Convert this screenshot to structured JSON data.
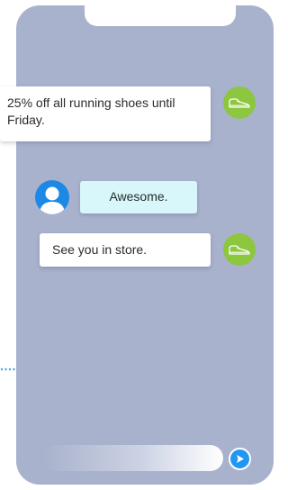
{
  "chat": {
    "messages": [
      {
        "sender": "store",
        "text": "25% off all running shoes until Friday.",
        "avatar_icon": "sneaker-icon"
      },
      {
        "sender": "user",
        "text": "Awesome.",
        "avatar_icon": "user-avatar-icon"
      },
      {
        "sender": "store",
        "text": "See you in store.",
        "avatar_icon": "sneaker-icon"
      }
    ]
  },
  "composer": {
    "placeholder": "",
    "send_icon": "send-icon"
  },
  "colors": {
    "phone_background": "#a9b2cc",
    "store_avatar": "#8dc63f",
    "user_avatar": "#1e88e5",
    "user_bubble": "#d7f7fb",
    "bot_bubble": "#ffffff",
    "send_button": "#2196f3",
    "connector_dots": "#3aa7e0"
  }
}
